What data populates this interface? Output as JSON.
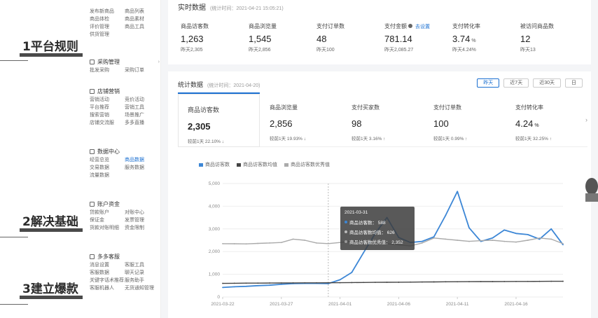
{
  "slide": {
    "titles": [
      "1平台规则",
      "2解决基础",
      "3建立爆款"
    ]
  },
  "sidebar": {
    "groups": [
      {
        "title": "",
        "rows": [
          [
            "发布新商品",
            "商品列表"
          ],
          [
            "商品体检",
            "商品素材"
          ],
          [
            "评价管理",
            "商品工具"
          ],
          [
            "供货管理",
            ""
          ]
        ]
      },
      {
        "title": "采购管理",
        "rows": [
          [
            "批发采购",
            "采购订单"
          ]
        ]
      },
      {
        "title": "店铺营销",
        "rows": [
          [
            "营销活动",
            "竞价活动"
          ],
          [
            "平台推荐",
            "营销工具"
          ],
          [
            "搜索营销",
            "场景推广"
          ],
          [
            "店铺交流服",
            "多多直播"
          ]
        ]
      },
      {
        "title": "数据中心",
        "rows": [
          [
            "经营总览",
            "商品数据"
          ],
          [
            "交易数据",
            "服务数据"
          ],
          [
            "流量数据",
            ""
          ]
        ]
      },
      {
        "title": "账户资金",
        "rows": [
          [
            "贷款账户",
            "对账中心"
          ],
          [
            "保证金",
            "发票管理"
          ],
          [
            "货款对账明细",
            "资金限制"
          ]
        ]
      },
      {
        "title": "多多客服",
        "rows": [
          [
            "消息设置",
            "客服工具"
          ],
          [
            "客服数据",
            "聊天记录"
          ],
          [
            "关键字话术推荐",
            "服务助手"
          ],
          [
            "客服机器人",
            "无货通知管理"
          ]
        ]
      }
    ]
  },
  "realtime": {
    "title": "实时数据",
    "time": "(统计时间：2021-04-21 15:05:21)",
    "metrics": [
      {
        "label": "商品访客数",
        "value": "1,263",
        "unit": "",
        "prev": "昨天2,305"
      },
      {
        "label": "商品浏览量",
        "value": "1,545",
        "unit": "",
        "prev": "昨天2,856"
      },
      {
        "label": "支付订单数",
        "value": "48",
        "unit": "",
        "prev": "昨天100"
      },
      {
        "label": "支付金额",
        "value": "781.14",
        "unit": "",
        "prev": "昨天2,085.27",
        "link": "去设置"
      },
      {
        "label": "支付转化率",
        "value": "3.74",
        "unit": "%",
        "prev": "昨天4.24%"
      },
      {
        "label": "被访问商品数",
        "value": "12",
        "unit": "",
        "prev": "昨天13"
      }
    ]
  },
  "stats": {
    "title": "统计数据",
    "time": "(统计时间：2021-04-20)",
    "buttons": [
      "昨天",
      "近7天",
      "近30天",
      "日"
    ],
    "active_button": 0,
    "tabs": [
      {
        "label": "商品访客数",
        "value": "2,305",
        "unit": "",
        "cmp": "较前1天  22.10% ↓"
      },
      {
        "label": "商品浏览量",
        "value": "2,856",
        "unit": "",
        "cmp": "较前1天  19.93% ↓"
      },
      {
        "label": "支付买家数",
        "value": "98",
        "unit": "",
        "cmp": "较前1天  3.16% ↑"
      },
      {
        "label": "支付订单数",
        "value": "100",
        "unit": "",
        "cmp": "较前1天  0.99% ↑"
      },
      {
        "label": "支付转化率",
        "value": "4.24",
        "unit": "%",
        "cmp": "较前1天  32.25% ↑"
      }
    ],
    "legend": [
      {
        "name": "商品访客数",
        "color": "#3d87d6"
      },
      {
        "name": "商品访客数均值",
        "color": "#444444"
      },
      {
        "name": "商品访客数优秀值",
        "color": "#aaaaaa"
      }
    ],
    "tooltip": {
      "date": "2021-03-31",
      "rows": [
        {
          "label": "商品访客数：  588",
          "color": "#3d87d6"
        },
        {
          "label": "商品访客数均值：  626",
          "color": "#444444"
        },
        {
          "label": "商品访客数优秀值：  2,352",
          "color": "#aaaaaa"
        }
      ]
    }
  },
  "chart_data": {
    "type": "line",
    "x": [
      "2021-03-22",
      "2021-03-23",
      "2021-03-24",
      "2021-03-25",
      "2021-03-26",
      "2021-03-27",
      "2021-03-28",
      "2021-03-29",
      "2021-03-30",
      "2021-03-31",
      "2021-04-01",
      "2021-04-02",
      "2021-04-03",
      "2021-04-04",
      "2021-04-05",
      "2021-04-06",
      "2021-04-07",
      "2021-04-08",
      "2021-04-09",
      "2021-04-10",
      "2021-04-11",
      "2021-04-12",
      "2021-04-13",
      "2021-04-14",
      "2021-04-15",
      "2021-04-16",
      "2021-04-17",
      "2021-04-18",
      "2021-04-19",
      "2021-04-20"
    ],
    "tick_labels": [
      "2021-03-22",
      "2021-03-27",
      "2021-04-01",
      "2021-04-06",
      "2021-04-11",
      "2021-04-16"
    ],
    "ylim": [
      0,
      5000
    ],
    "y_ticks": [
      0,
      1000,
      2000,
      3000,
      4000,
      5000
    ],
    "y_tick_labels": [
      "0",
      "1,000",
      "2,000",
      "3,000",
      "4,000",
      "5,000"
    ],
    "series": [
      {
        "name": "商品访客数",
        "color": "#3d87d6",
        "values": [
          420,
          450,
          470,
          500,
          520,
          560,
          590,
          600,
          600,
          588,
          760,
          1080,
          1950,
          2800,
          3500,
          2620,
          2400,
          2450,
          2650,
          3600,
          4650,
          3050,
          2450,
          2600,
          2950,
          2800,
          2750,
          2550,
          3000,
          2305
        ]
      },
      {
        "name": "商品访客数均值",
        "color": "#444444",
        "values": [
          600,
          605,
          610,
          612,
          615,
          618,
          620,
          622,
          624,
          626,
          630,
          635,
          640,
          645,
          648,
          650,
          655,
          660,
          665,
          670,
          672,
          675,
          678,
          680,
          682,
          684,
          686,
          688,
          690,
          692
        ]
      },
      {
        "name": "商品访客数优秀值",
        "color": "#aaaaaa",
        "values": [
          2350,
          2345,
          2340,
          2360,
          2380,
          2400,
          2550,
          2500,
          2380,
          2352,
          2400,
          2450,
          2480,
          2470,
          2350,
          2300,
          2250,
          2380,
          2600,
          2550,
          2500,
          2450,
          2480,
          2500,
          2450,
          2420,
          2500,
          2600,
          2550,
          2350
        ]
      }
    ],
    "grid": true,
    "legend_position": "top-left"
  }
}
